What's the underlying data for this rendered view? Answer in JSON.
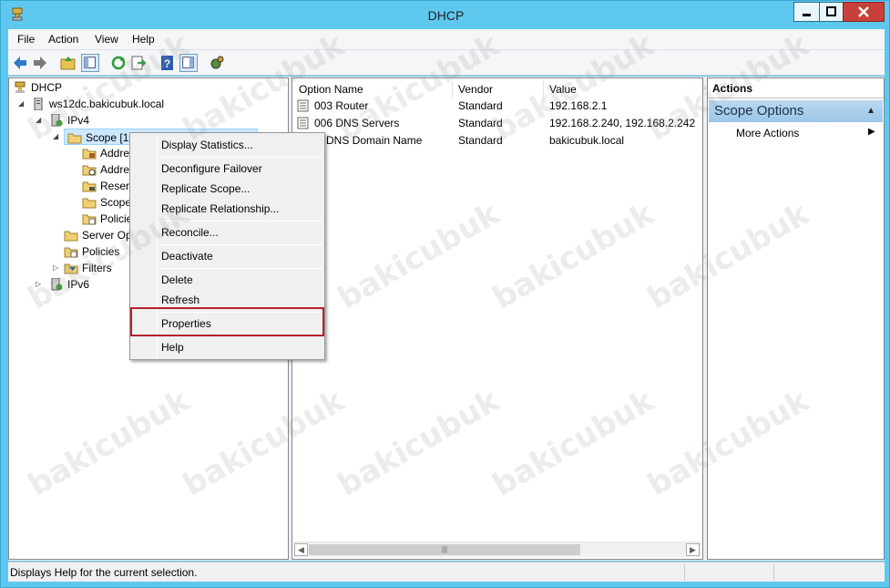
{
  "window": {
    "title": "DHCP"
  },
  "menu": [
    "File",
    "Action",
    "View",
    "Help"
  ],
  "tree": {
    "root": "DHCP",
    "server": "ws12dc.bakicubuk.local",
    "ipv4": "IPv4",
    "scope": "Scope [19",
    "scope_children": [
      "Addre",
      "Addre",
      "Reserv",
      "Scope",
      "Policie"
    ],
    "server_options": "Server Op",
    "policies": "Policies",
    "filters": "Filters",
    "ipv6": "IPv6"
  },
  "list": {
    "columns": [
      "Option Name",
      "Vendor",
      "Value"
    ],
    "rows": [
      {
        "name": "003 Router",
        "vendor": "Standard",
        "value": "192.168.2.1"
      },
      {
        "name": "006 DNS Servers",
        "vendor": "Standard",
        "value": "192.168.2.240, 192.168.2.242"
      },
      {
        "name": "5 DNS Domain Name",
        "vendor": "Standard",
        "value": "bakicubuk.local"
      }
    ]
  },
  "actions": {
    "title": "Actions",
    "group": "Scope Options",
    "item": "More Actions"
  },
  "context_menu": {
    "items": [
      "Display Statistics...",
      "Deconfigure Failover",
      "Replicate Scope...",
      "Replicate Relationship...",
      "Reconcile...",
      "Deactivate",
      "Delete",
      "Refresh",
      "Properties",
      "Help"
    ]
  },
  "status": {
    "text": "Displays Help for the current selection."
  },
  "watermark": "bakicubuk",
  "colors": {
    "titlebar": "#5ec8ee",
    "close": "#c7413a",
    "highlight": "#b6202a",
    "actions_group": "#b9d8f0"
  }
}
